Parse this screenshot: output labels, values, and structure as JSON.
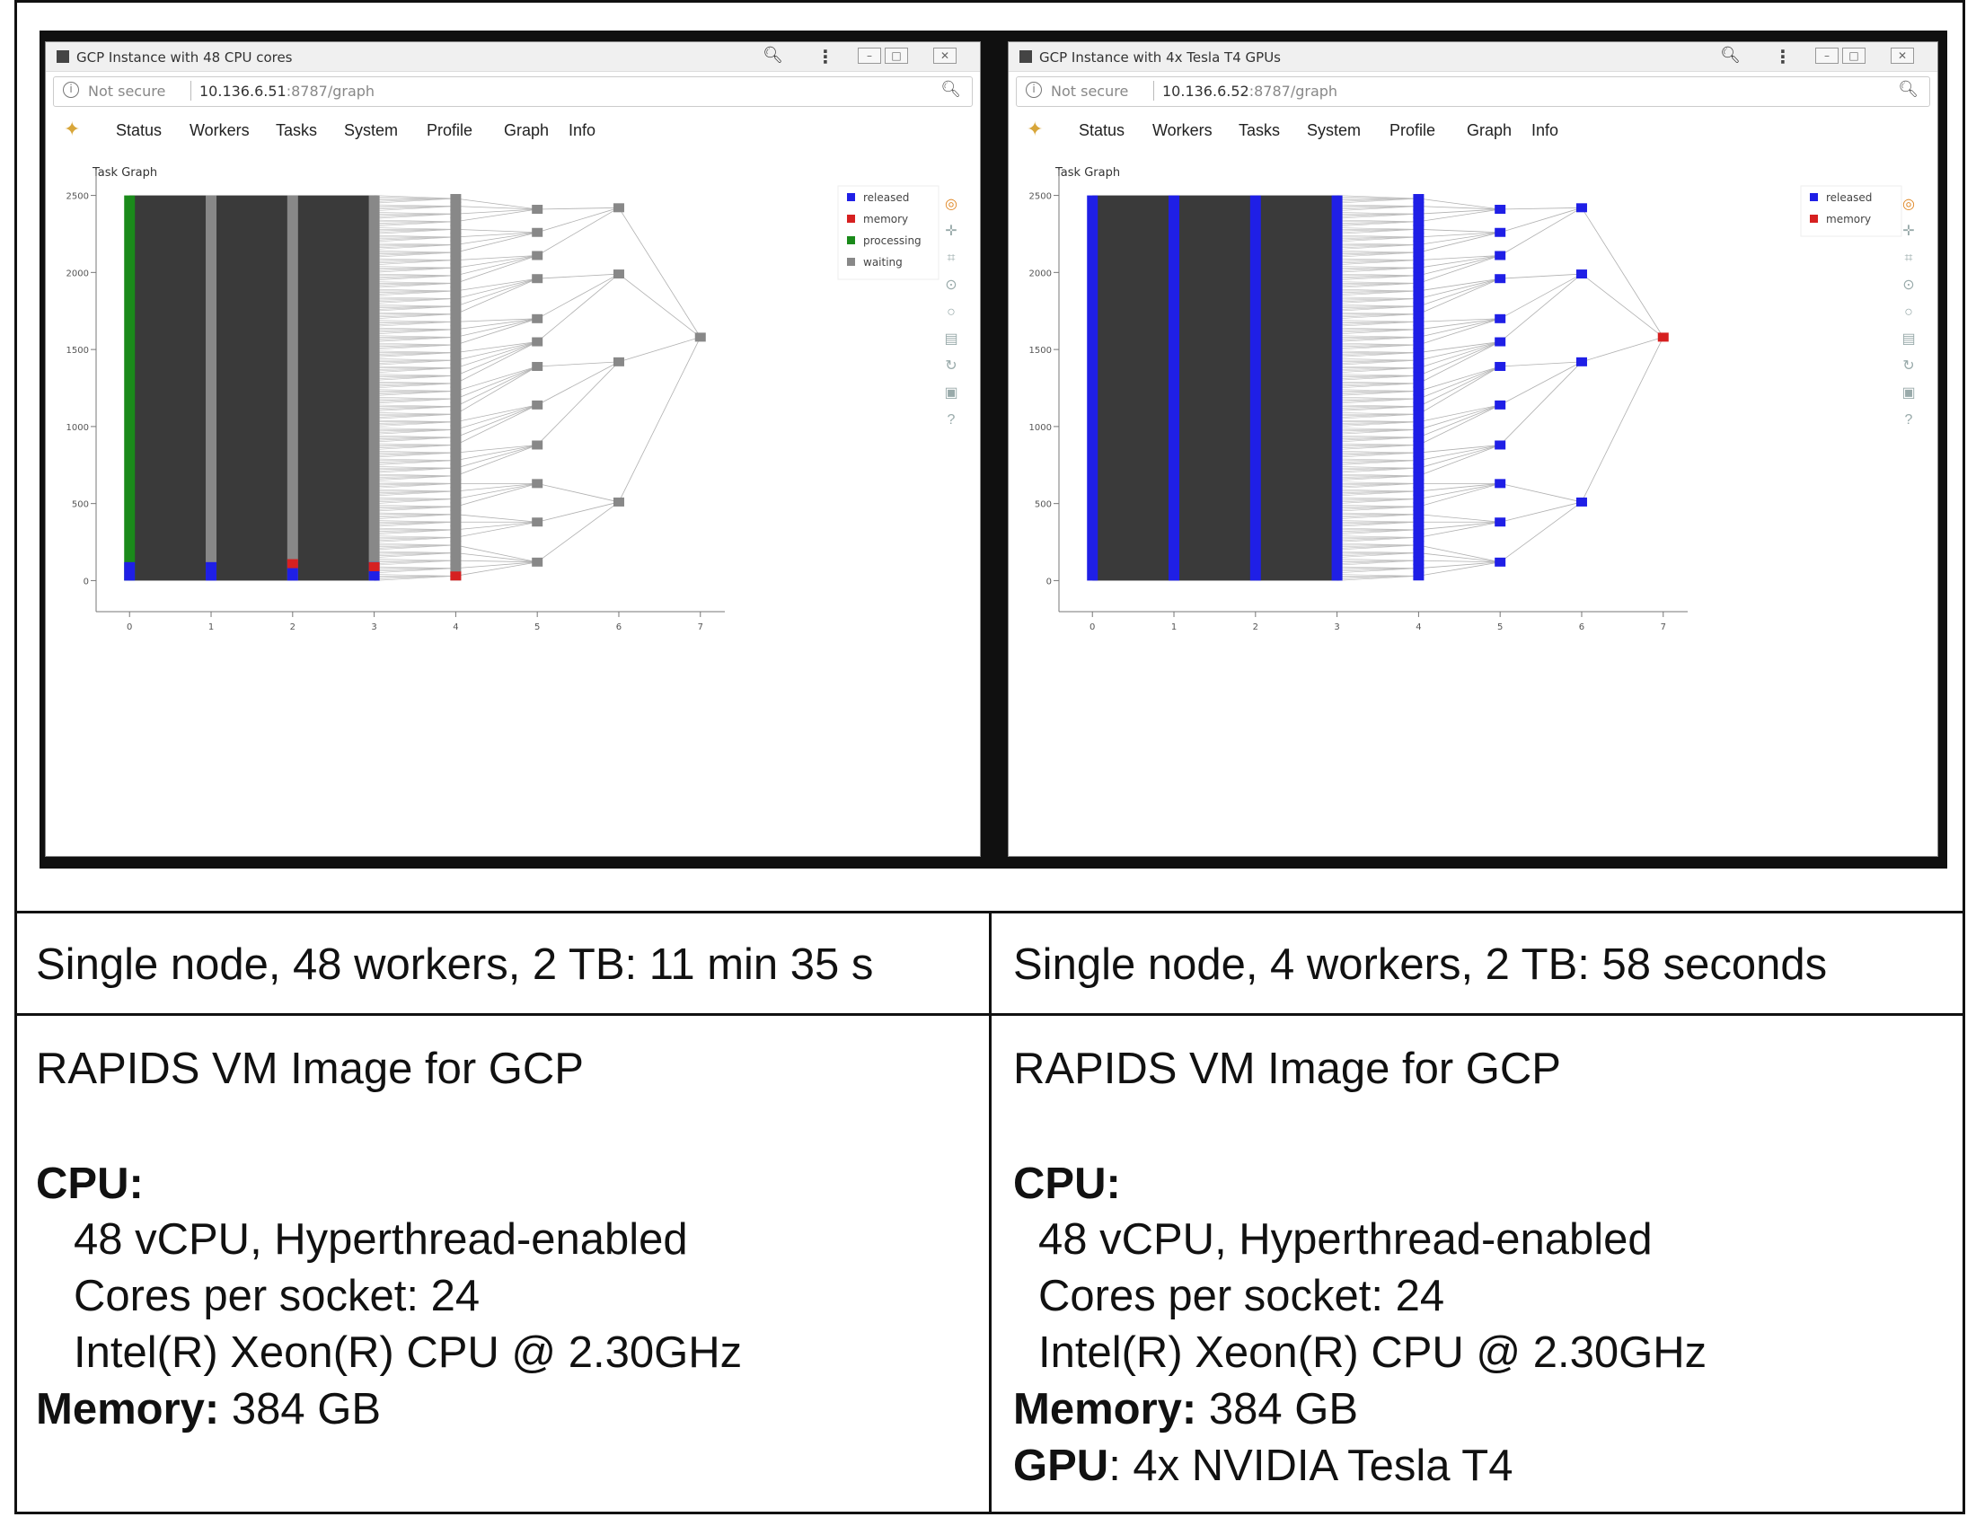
{
  "windows": [
    {
      "id": "left",
      "title": "GCP Instance with 48 CPU cores",
      "address": {
        "not_secure": "Not secure",
        "host": "10.136.6.51",
        "path": ":8787/graph"
      },
      "nav": [
        "Status",
        "Workers",
        "Tasks",
        "System",
        "Profile",
        "Graph",
        "Info"
      ],
      "plot_title": "Task Graph",
      "legend": [
        {
          "label": "released",
          "color": "#1f1fe6"
        },
        {
          "label": "memory",
          "color": "#d62020"
        },
        {
          "label": "processing",
          "color": "#1a8a1a"
        },
        {
          "label": "waiting",
          "color": "#888888"
        }
      ]
    },
    {
      "id": "right",
      "title": "GCP Instance with 4x Tesla T4 GPUs",
      "address": {
        "not_secure": "Not secure",
        "host": "10.136.6.52",
        "path": ":8787/graph"
      },
      "nav": [
        "Status",
        "Workers",
        "Tasks",
        "System",
        "Profile",
        "Graph",
        "Info"
      ],
      "plot_title": "Task Graph",
      "legend": [
        {
          "label": "released",
          "color": "#1f1fe6"
        },
        {
          "label": "memory",
          "color": "#d62020"
        }
      ]
    }
  ],
  "chart_data": [
    {
      "type": "scatter",
      "title": "Task Graph",
      "x_ticks": [
        "0",
        "1",
        "2",
        "3",
        "4",
        "5",
        "6",
        "7"
      ],
      "y_ticks": [
        "0",
        "500",
        "1000",
        "1500",
        "2000",
        "2500"
      ],
      "xlim": [
        -0.3,
        7.3
      ],
      "ylim": [
        -120,
        2620
      ],
      "columns": [
        {
          "x": 0,
          "nodes": 2500,
          "state": "processing"
        },
        {
          "x": 1,
          "nodes": 2500,
          "state": "waiting"
        },
        {
          "x": 2,
          "nodes": 2500,
          "state": "waiting"
        },
        {
          "x": 3,
          "nodes": 2500,
          "state": "waiting"
        },
        {
          "x": 4,
          "y": [
            30,
            80,
            130,
            180,
            230,
            280,
            330,
            380,
            430,
            480,
            530,
            580,
            630,
            680,
            730,
            780,
            830,
            880,
            930,
            980,
            1030,
            1080,
            1130,
            1180,
            1230,
            1280,
            1330,
            1380,
            1430,
            1480,
            1530,
            1580,
            1630,
            1680,
            1730,
            1780,
            1830,
            1880,
            1930,
            1980,
            2030,
            2080,
            2130,
            2180,
            2230,
            2280,
            2330,
            2380,
            2430,
            2480
          ],
          "state": "waiting"
        },
        {
          "x": 5,
          "y": [
            120,
            380,
            630,
            880,
            1140,
            1390,
            1550,
            1700,
            1960,
            2110,
            2260,
            2410
          ],
          "state": "waiting"
        },
        {
          "x": 6,
          "y": [
            510,
            1420,
            1990,
            2420
          ],
          "state": "waiting"
        },
        {
          "x": 7,
          "y": [
            1580
          ],
          "state": "waiting"
        }
      ],
      "released_y_max": 120,
      "memory_markers": [
        {
          "x": 2,
          "y": 110
        },
        {
          "x": 3,
          "y": 90
        },
        {
          "x": 4,
          "y": 30
        }
      ]
    },
    {
      "type": "scatter",
      "title": "Task Graph",
      "x_ticks": [
        "0",
        "1",
        "2",
        "3",
        "4",
        "5",
        "6",
        "7"
      ],
      "y_ticks": [
        "0",
        "500",
        "1000",
        "1500",
        "2000",
        "2500"
      ],
      "xlim": [
        -0.3,
        7.3
      ],
      "ylim": [
        -120,
        2620
      ],
      "columns": [
        {
          "x": 0,
          "nodes": 2500,
          "state": "released"
        },
        {
          "x": 1,
          "nodes": 2500,
          "state": "released"
        },
        {
          "x": 2,
          "nodes": 2500,
          "state": "released"
        },
        {
          "x": 3,
          "nodes": 2500,
          "state": "released"
        },
        {
          "x": 4,
          "y": [
            30,
            80,
            130,
            180,
            230,
            280,
            330,
            380,
            430,
            480,
            530,
            580,
            630,
            680,
            730,
            780,
            830,
            880,
            930,
            980,
            1030,
            1080,
            1130,
            1180,
            1230,
            1280,
            1330,
            1380,
            1430,
            1480,
            1530,
            1580,
            1630,
            1680,
            1730,
            1780,
            1830,
            1880,
            1930,
            1980,
            2030,
            2080,
            2130,
            2180,
            2230,
            2280,
            2330,
            2380,
            2430,
            2480
          ],
          "state": "released"
        },
        {
          "x": 5,
          "y": [
            120,
            380,
            630,
            880,
            1140,
            1390,
            1550,
            1700,
            1960,
            2110,
            2260,
            2410
          ],
          "state": "released"
        },
        {
          "x": 6,
          "y": [
            510,
            1420,
            1990,
            2420
          ],
          "state": "released"
        },
        {
          "x": 7,
          "y": [
            1580
          ],
          "state": "memory"
        }
      ]
    }
  ],
  "table": {
    "row1": {
      "left": "Single node, 48 workers, 2 TB: 11 min 35 s",
      "right": "Single node, 4 workers, 2 TB: 58 seconds"
    },
    "row2": {
      "left": {
        "heading": "RAPIDS VM Image for GCP",
        "cpu_label": "CPU:",
        "cpu_lines": [
          "48 vCPU, Hyperthread-enabled",
          "Cores per socket: 24",
          "Intel(R) Xeon(R) CPU @ 2.30GHz"
        ],
        "memory_label": "Memory:",
        "memory_value": " 384 GB"
      },
      "right": {
        "heading": "RAPIDS VM Image for GCP",
        "cpu_label": "CPU:",
        "cpu_lines": [
          "48 vCPU, Hyperthread-enabled",
          "Cores per socket: 24",
          "Intel(R) Xeon(R) CPU @ 2.30GHz"
        ],
        "memory_label": "Memory:",
        "memory_value": " 384 GB",
        "gpu_label": "GPU",
        "gpu_value": ": 4x NVIDIA Tesla T4"
      }
    }
  }
}
